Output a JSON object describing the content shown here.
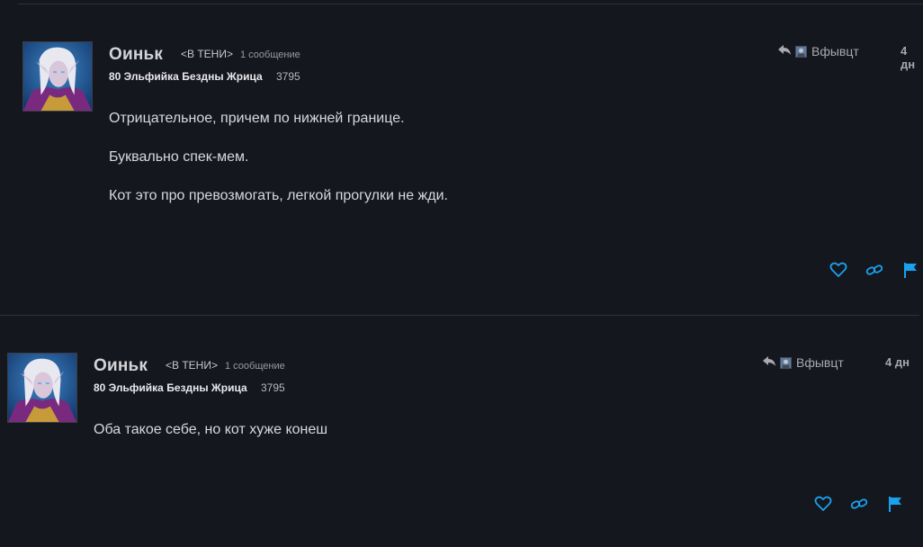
{
  "posts": [
    {
      "author": "Оиньк",
      "guild": "<В ТЕНИ>",
      "post_count": "1 сообщение",
      "character": "80 Эльфийка Бездны Жрица",
      "achievement_points": "3795",
      "reply_to": "Вфывцт",
      "date": "4 дн",
      "paragraphs": [
        "Отрицательное, причем по нижней границе.",
        "Буквально спек-мем.",
        "Кот это про превозмогать, легкой прогулки не жди."
      ]
    },
    {
      "author": "Оиньк",
      "guild": "<В ТЕНИ>",
      "post_count": "1 сообщение",
      "character": "80 Эльфийка Бездны Жрица",
      "achievement_points": "3795",
      "reply_to": "Вфывцт",
      "date": "4 дн",
      "paragraphs": [
        "Оба такое себе, но кот хуже конеш"
      ]
    }
  ],
  "icons": {
    "reply": "reply-arrow-icon",
    "like": "heart-icon",
    "link": "link-icon",
    "flag": "flag-icon"
  },
  "colors": {
    "background": "#15171f",
    "accent": "#1aa1ee",
    "text": "#d8d8dc"
  }
}
